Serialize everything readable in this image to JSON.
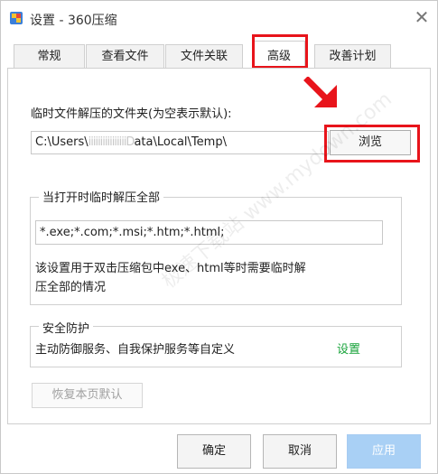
{
  "window": {
    "title": "设置 - 360压缩",
    "close_glyph": "✕"
  },
  "tabs": [
    {
      "label": "常规",
      "active": false
    },
    {
      "label": "查看文件",
      "active": false
    },
    {
      "label": "文件关联",
      "active": false
    },
    {
      "label": "高级",
      "active": true
    },
    {
      "label": "改善计划",
      "active": false
    }
  ],
  "temp_folder": {
    "label": "临时文件解压的文件夹(为空表示默认):",
    "value_prefix": "C:\\Users\\",
    "value_obscured": "iiiiiiiiiiiiiiiiD",
    "value_suffix": "ata\\Local\\Temp\\",
    "browse_label": "浏览"
  },
  "extract_on_open": {
    "title": "当打开时临时解压全部",
    "extensions": "*.exe;*.com;*.msi;*.htm;*.html;",
    "description_line1": "该设置用于双击压缩包中exe、html等时需要临时解",
    "description_line2": "压全部的情况"
  },
  "security": {
    "title": "安全防护",
    "description": "主动防御服务、自我保护服务等自定义",
    "settings_link": "设置"
  },
  "restore_defaults_label": "恢复本页默认",
  "buttons": {
    "ok": "确定",
    "cancel": "取消",
    "apply": "应用"
  },
  "watermark": "极速下载站 www.mydown.com",
  "colors": {
    "highlight_red": "#e8141b",
    "link_green": "#17a33a",
    "apply_blue": "#a9d0f5"
  }
}
